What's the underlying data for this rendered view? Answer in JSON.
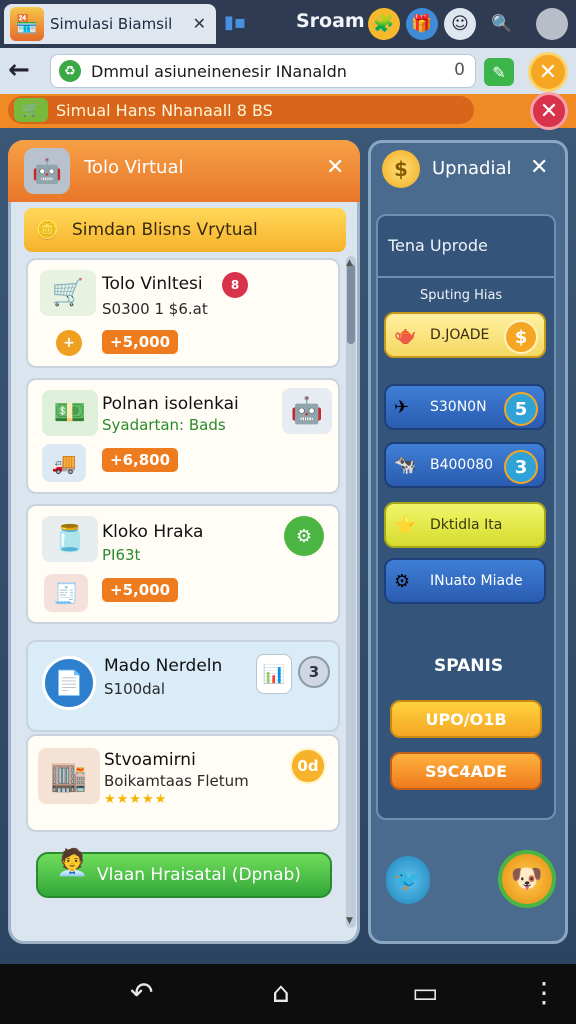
{
  "browser": {
    "tab_title": "Simulasi Biamsil",
    "tab_close": "✕",
    "brand": "Sroam",
    "url": "Dmmul asiuneinenesir INanaldn",
    "reload": "0"
  },
  "banner": {
    "text": "Simual Hans Nhanaall 8 BS"
  },
  "left_panel": {
    "title": "Tolo Virtual",
    "close": "✕",
    "subtitle": "Simdan Blisns Vrytual",
    "cards": [
      {
        "title": "Tolo Vinltesi",
        "sub": "S0300 1  $6.at",
        "price": "+5,000",
        "badge": "8"
      },
      {
        "title": "Polnan isolenkai",
        "sub": "Syadartan: Bads",
        "price": "+6,800",
        "badge": ""
      },
      {
        "title": "Kloko Hraka",
        "sub": "PI63t",
        "price": "+5,000",
        "badge": ""
      },
      {
        "title": "Mado Nerdeln",
        "sub": "S100dal",
        "price": "",
        "badge": "3"
      },
      {
        "title": "Stvoamirni",
        "sub": "Boikamtaas Fletum",
        "price": "",
        "badge": "0d",
        "rating": "★★★★★"
      }
    ],
    "cta": "Vlaan Hraisatal  (Dpnab)"
  },
  "right_panel": {
    "title": "Upnadial",
    "close": "✕",
    "coin": "$",
    "inner_title": "Tena Uprode",
    "label": "Sputing Hias",
    "buttons": [
      {
        "text": "D.JOADE",
        "badge": "$"
      },
      {
        "text": "S30N0N",
        "badge": "5"
      },
      {
        "text": "B400080",
        "badge": "3"
      },
      {
        "text": "Dktidla Ita",
        "badge": ""
      },
      {
        "text": "INuato Miade",
        "badge": ""
      }
    ],
    "section": "SPANIS",
    "pills": [
      "UPO/O1B",
      "S9C4ADE"
    ]
  },
  "colors": {
    "orange": "#ee7b1d",
    "green": "#33a83a",
    "panel_blue": "#4a6a8e"
  }
}
